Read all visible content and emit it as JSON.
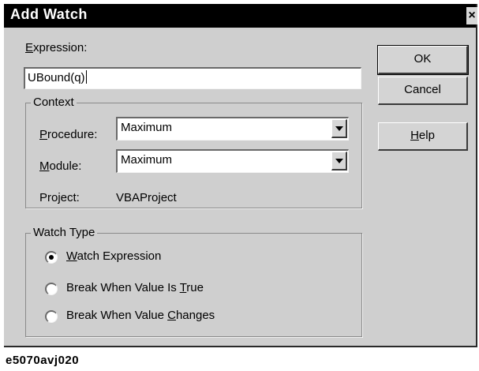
{
  "dialog": {
    "title": "Add Watch",
    "close_glyph": "×"
  },
  "expression": {
    "label": "Expression:",
    "label_mnemonic": "E",
    "label_rest": "xpression:",
    "value": "UBound(q)"
  },
  "context": {
    "title": "Context",
    "procedure": {
      "label": "Procedure:",
      "mnemonic": "P",
      "rest": "rocedure:",
      "value": "Maximum"
    },
    "module": {
      "label": "Module:",
      "mnemonic": "M",
      "rest": "odule:",
      "value": "Maximum"
    },
    "project": {
      "label": "Project:",
      "value": "VBAProject"
    }
  },
  "watch_type": {
    "title": "Watch Type",
    "options": [
      {
        "label": "Watch Expression",
        "mnemonic": "W",
        "before": "",
        "rest": "atch Expression",
        "checked": true
      },
      {
        "label": "Break When Value Is True",
        "before": "Break When Value Is ",
        "mnemonic": "T",
        "rest": "rue",
        "checked": false
      },
      {
        "label": "Break When Value Changes",
        "before": "Break When Value ",
        "mnemonic": "C",
        "rest": "hanges",
        "checked": false
      }
    ]
  },
  "buttons": {
    "ok": "OK",
    "cancel": "Cancel",
    "help": "Help",
    "help_mnemonic": "H",
    "help_rest": "elp"
  },
  "caption": "e5070avj020",
  "icons": {
    "close": "close-icon",
    "dropdown": "chevron-down-icon"
  },
  "colors": {
    "title_bar": "#000000",
    "dialog_face": "#cfcfcf",
    "field_bg": "#ffffff"
  }
}
